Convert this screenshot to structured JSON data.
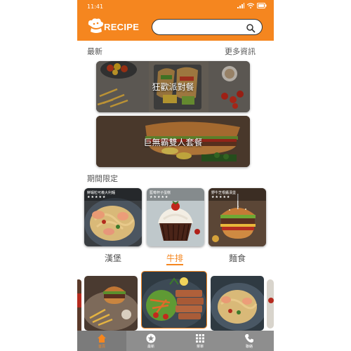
{
  "status_bar": {
    "time": "11:41",
    "icons": [
      "signal-icon",
      "wifi-icon",
      "battery-icon"
    ]
  },
  "header": {
    "logo_text": "RECIPE",
    "search": {
      "placeholder": "",
      "value": ""
    },
    "brand_color": "#f5861f"
  },
  "latest": {
    "title": "最新",
    "more_label": "更多資訊",
    "banners": [
      {
        "label": "狂歡派對餐"
      },
      {
        "label": "巨無霸雙人套餐"
      }
    ]
  },
  "limited": {
    "title": "期間限定",
    "cards": [
      {
        "caption": "鮮蝦粒可義大利麵",
        "stars": "★★★★★"
      },
      {
        "caption": "藍莓杯子蛋糕",
        "stars": "★★★★★"
      },
      {
        "caption": "野牛芝根醬漢堡",
        "stars": "★★★★★"
      }
    ]
  },
  "tabs": [
    {
      "label": "漢堡",
      "active": false
    },
    {
      "label": "牛排",
      "active": true
    },
    {
      "label": "麵食",
      "active": false
    }
  ],
  "bottom_nav": [
    {
      "label": "首頁",
      "icon": "home-icon",
      "active": true
    },
    {
      "label": "最新",
      "icon": "star-icon",
      "active": false
    },
    {
      "label": "菜單",
      "icon": "grid-icon",
      "active": false
    },
    {
      "label": "聯絡",
      "icon": "phone-icon",
      "active": false
    }
  ]
}
